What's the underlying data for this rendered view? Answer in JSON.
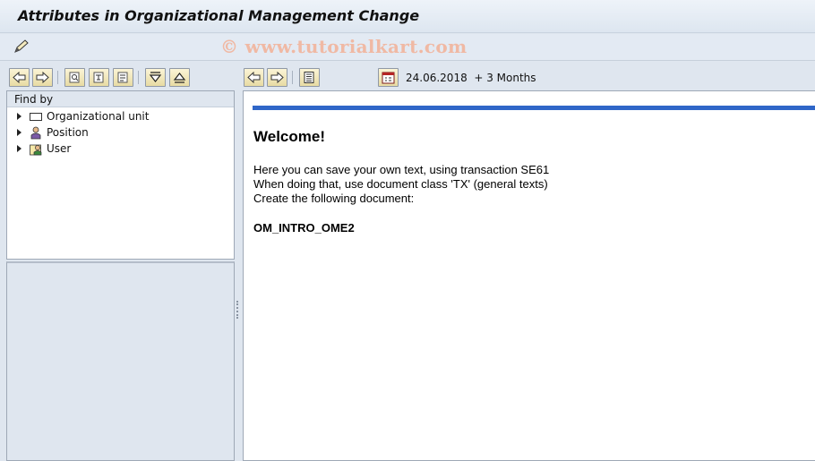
{
  "window": {
    "title": "Attributes in Organizational Management Change"
  },
  "app_toolbar": {
    "watermark": "© www.tutorialkart.com",
    "icons": [
      "pencil-icon"
    ]
  },
  "left_toolbar": {
    "buttons": [
      "back-icon",
      "forward-icon",
      "find-icon",
      "structure-search-icon",
      "search-term-icon",
      "expand-icon",
      "collapse-icon"
    ]
  },
  "findby": {
    "header": "Find by",
    "items": [
      {
        "label": "Organizational unit",
        "icon": "org-unit-icon"
      },
      {
        "label": "Position",
        "icon": "position-icon"
      },
      {
        "label": "User",
        "icon": "user-icon"
      }
    ]
  },
  "right_toolbar": {
    "buttons": [
      "back-icon",
      "forward-icon",
      "overview-icon",
      "calendar-icon"
    ],
    "date": "24.06.2018",
    "period": "+ 3 Months"
  },
  "content": {
    "heading": "Welcome!",
    "line1": "Here you can save your own text, using transaction SE61",
    "line2": "When doing that, use document class 'TX' (general texts)",
    "line3": "Create the following document:",
    "document_name": "OM_INTRO_OME2"
  },
  "colors": {
    "accent_line": "#2f66c8",
    "button_face": "#f3e9bd",
    "background": "#dfe6ef"
  }
}
